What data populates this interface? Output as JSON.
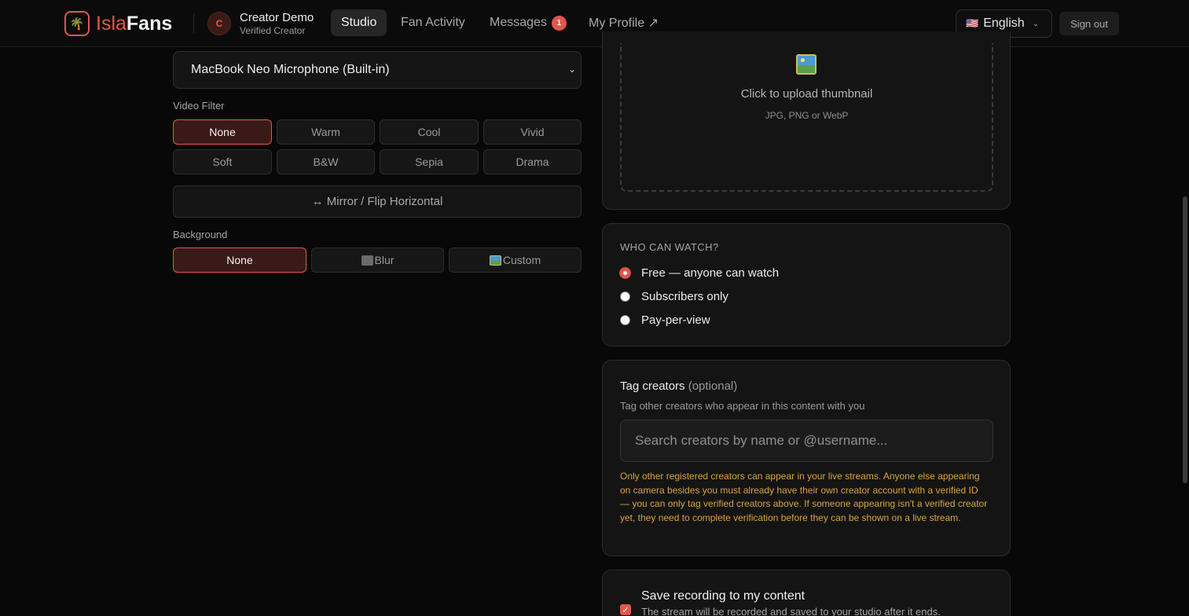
{
  "header": {
    "logo_light": "Isla",
    "logo_bold": "Fans",
    "avatar_initial": "C",
    "user_name": "Creator Demo",
    "user_role": "Verified Creator",
    "nav": {
      "studio": "Studio",
      "fan_activity": "Fan Activity",
      "messages": "Messages",
      "messages_badge": "1",
      "my_profile": "My Profile ↗"
    },
    "language": {
      "flag": "🇺🇸",
      "label": "English"
    },
    "sign_out": "Sign out"
  },
  "left": {
    "microphone": "MacBook Neo Microphone (Built-in)",
    "video_filter_label": "Video Filter",
    "filters": [
      "None",
      "Warm",
      "Cool",
      "Vivid",
      "Soft",
      "B&W",
      "Sepia",
      "Drama"
    ],
    "selected_filter": "None",
    "mirror_label": "↔ Mirror / Flip Horizontal",
    "background_label": "Background",
    "backgrounds": [
      "None",
      "Blur",
      "Custom"
    ],
    "selected_background": "None"
  },
  "thumbnail": {
    "title": "Click to upload thumbnail",
    "subtitle": "JPG, PNG or WebP"
  },
  "who_can_watch": {
    "title": "WHO CAN WATCH?",
    "options": [
      "Free — anyone can watch",
      "Subscribers only",
      "Pay-per-view"
    ],
    "selected": "Free — anyone can watch"
  },
  "tag_creators": {
    "title": "Tag creators",
    "optional": "(optional)",
    "subtitle": "Tag other creators who appear in this content with you",
    "placeholder": "Search creators by name or @username...",
    "notice": "Only other registered creators can appear in your live streams. Anyone else appearing on camera besides you must already have their own creator account with a verified ID — you can only tag verified creators above. If someone appearing isn't a verified creator yet, they need to complete verification before they can be shown on a live stream."
  },
  "recording": {
    "title": "Save recording to my content",
    "subtitle": "The stream will be recorded and saved to your studio after it ends.",
    "checked": true
  },
  "colors": {
    "accent": "#e2574c",
    "background": "#080808",
    "card": "#141414",
    "warning": "#d8a441"
  }
}
